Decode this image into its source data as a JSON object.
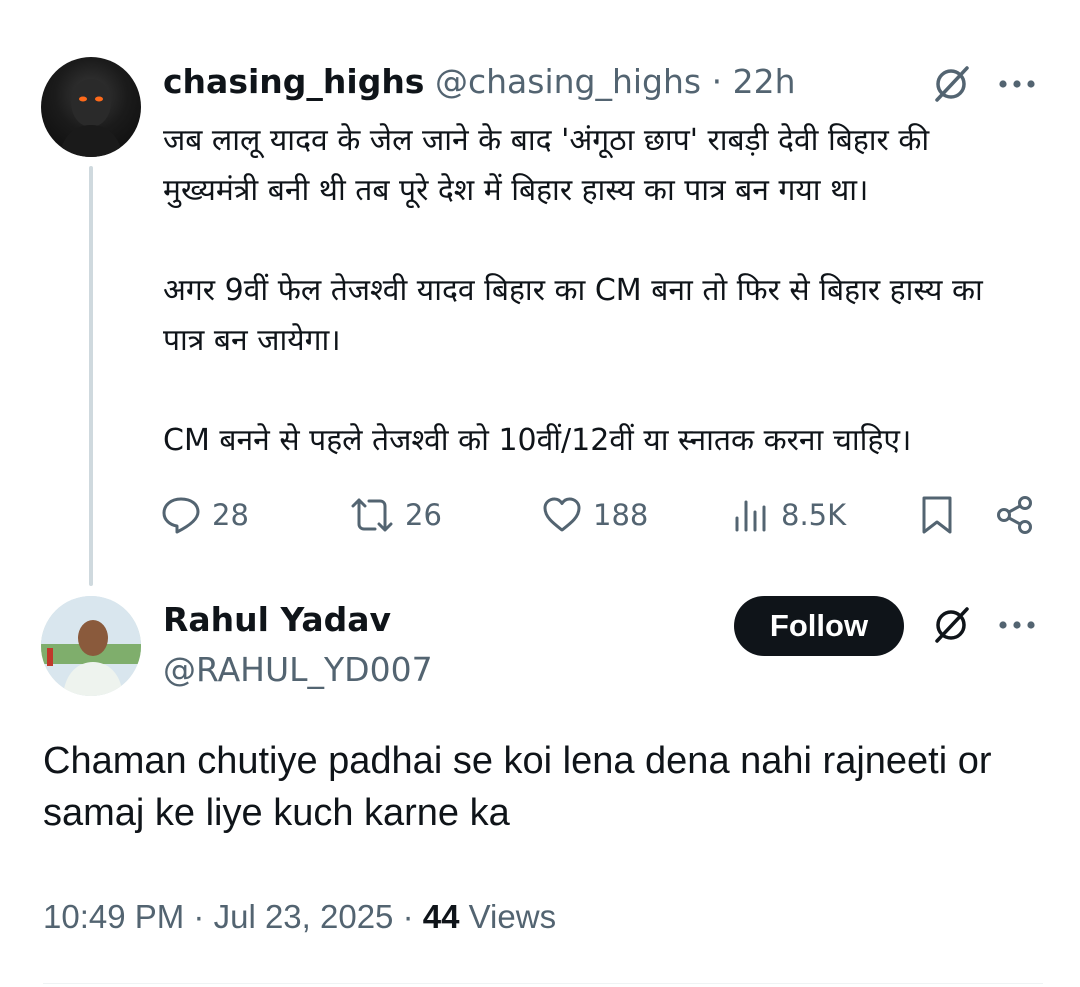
{
  "parent_tweet": {
    "display_name": "chasing_highs",
    "handle": "@chasing_highs",
    "separator": "·",
    "time_ago": "22h",
    "text": "जब लालू यादव के जेल जाने के बाद 'अंगूठा छाप' राबड़ी देवी बिहार की मुख्यमंत्री बनी थी तब पूरे देश में बिहार हास्य का पात्र बन गया था।\n\nअगर 9वीं फेल तेजश्वी यादव बिहार का CM बना तो फिर से बिहार हास्य का पात्र बन जायेगा।\n\nCM बनने से पहले तेजश्वी को 10वीं/12वीं या स्नातक करना चाहिए।",
    "stats": {
      "replies": "28",
      "retweets": "26",
      "likes": "188",
      "views": "8.5K"
    }
  },
  "reply_tweet": {
    "display_name": "Rahul Yadav",
    "handle": "@RAHUL_YD007",
    "follow_label": "Follow",
    "text": "Chaman chutiye padhai se koi lena dena nahi rajneeti or samaj ke liye kuch karne ka",
    "time": "10:49 PM",
    "date": "Jul 23, 2025",
    "separator": "·",
    "views_count": "44",
    "views_label": "Views"
  },
  "icons": {
    "grok": "grok-icon",
    "more": "more-icon",
    "reply": "reply-icon",
    "retweet": "retweet-icon",
    "like": "heart-icon",
    "views": "views-icon",
    "bookmark": "bookmark-icon",
    "share": "share-icon"
  },
  "colors": {
    "text_primary": "#0f1419",
    "text_secondary": "#536471",
    "thread_line": "#cfd9de",
    "follow_bg": "#0f1419",
    "follow_text": "#ffffff"
  }
}
